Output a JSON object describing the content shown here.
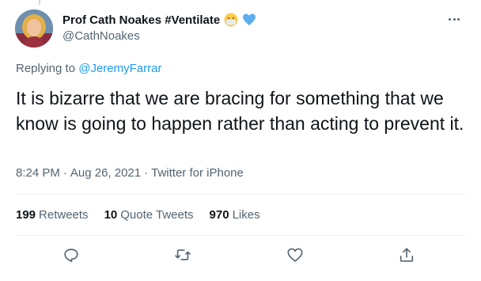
{
  "author": {
    "display_name": "Prof Cath Noakes #Ventilate",
    "handle": "@CathNoakes",
    "name_emojis": [
      "face-with-medical-mask-emoji",
      "blue-heart-emoji"
    ]
  },
  "reply": {
    "prefix": "Replying to",
    "to": "@JeremyFarrar"
  },
  "tweet": {
    "text": "It is bizarre that we are bracing for something that we know is going to happen rather than acting to prevent it."
  },
  "meta": {
    "time": "8:24 PM",
    "date": "Aug 26, 2021",
    "source": "Twitter for iPhone",
    "separator": "·"
  },
  "stats": {
    "retweets_count": "199",
    "retweets_label": "Retweets",
    "quotes_count": "10",
    "quotes_label": "Quote Tweets",
    "likes_count": "970",
    "likes_label": "Likes"
  },
  "actions": [
    "reply-icon",
    "retweet-icon",
    "like-icon",
    "share-icon"
  ],
  "colors": {
    "link": "#1d9bf0",
    "secondary_text": "#536471",
    "primary_text": "#0f1419",
    "divider": "#eff3f4"
  }
}
